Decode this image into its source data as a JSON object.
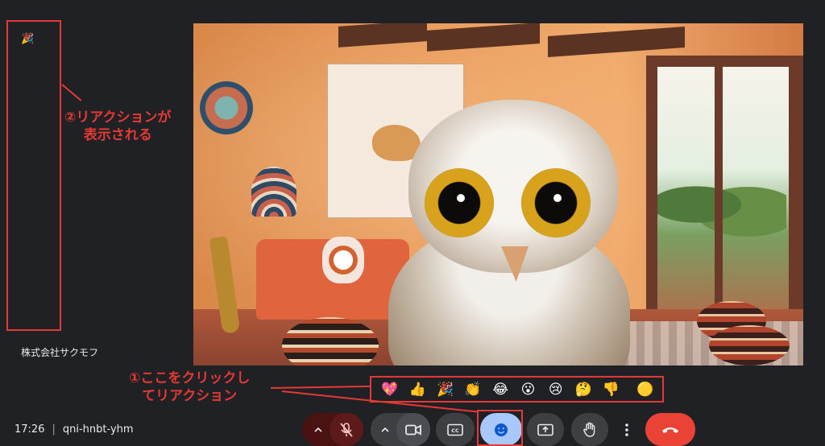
{
  "sidebar": {
    "floating_reaction": "🎉",
    "participant_name": "株式会社サクモフ"
  },
  "annotations": {
    "reaction_shown_line1": "②リアクションが",
    "reaction_shown_line2": "表示される",
    "click_here_line1": "①ここをクリックし",
    "click_here_line2": "てリアクション",
    "color": "#e53935"
  },
  "reaction_bar": {
    "emojis": [
      "💖",
      "👍",
      "🎉",
      "👏",
      "😂",
      "😮",
      "😢",
      "🤔",
      "👎"
    ],
    "skin_tone_label": "🟡"
  },
  "meeting": {
    "time": "17:26",
    "separator": "|",
    "code": "qni-hnbt-yhm"
  },
  "controls": {
    "mic_icon": "mic-off-icon",
    "camera_icon": "videocam-icon",
    "captions_icon": "closed-captions-icon",
    "reactions_icon": "emoji-icon",
    "present_icon": "present-screen-icon",
    "hand_icon": "raise-hand-icon",
    "more_icon": "more-vert-icon",
    "leave_icon": "call-end-icon",
    "leave_color": "#ea4335",
    "reactions_active_color": "#a8c7fa"
  }
}
